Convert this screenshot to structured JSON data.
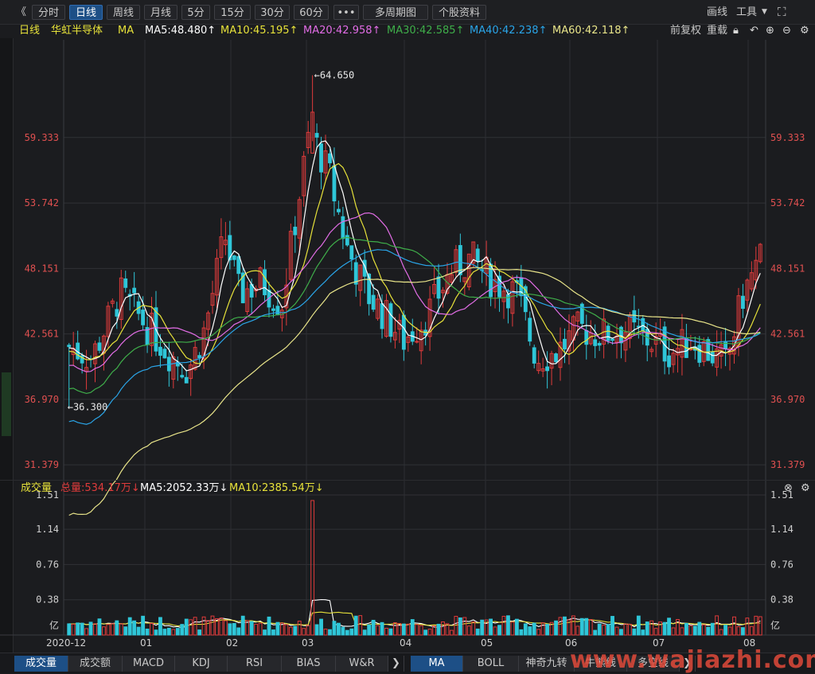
{
  "toolbar": {
    "collapse": "《",
    "tabs": [
      "分时",
      "日线",
      "周线",
      "月线",
      "5分",
      "15分",
      "30分",
      "60分",
      "•••",
      "多周期图",
      "个股资料"
    ],
    "active_tab": "日线",
    "draw_label": "画线",
    "tools_label": "工具",
    "tools_arrow": "▼",
    "fullscreen": "⛶"
  },
  "ma_bar": {
    "period": "日线",
    "stock_name": "华虹半导体",
    "ma_label": "MA",
    "ma5": "MA5:48.480↑",
    "ma10": "MA10:45.195↑",
    "ma20": "MA20:42.958↑",
    "ma30": "MA30:42.585↑",
    "ma40": "MA40:42.238↑",
    "ma60": "MA60:42.118↑",
    "adjust": "前复权",
    "reset": "重载"
  },
  "volume_bar": {
    "label": "成交量",
    "total": "总量:534.17万↓",
    "ma5": "MA5:2052.33万↓",
    "ma10": "MA10:2385.54万↓"
  },
  "colors": {
    "up": "#e03b3b",
    "down": "#2fc6d8",
    "ma5": "#ffffff",
    "ma10": "#e7e23a",
    "ma20": "#e26de6",
    "ma30": "#3fae4a",
    "ma40": "#2aa5e8",
    "ma60": "#e9e58a"
  },
  "chart_data": {
    "type": "candlestick",
    "price_axis_ticks": [
      "59.333",
      "53.742",
      "48.151",
      "42.561",
      "36.970",
      "31.379"
    ],
    "price_ylim": [
      30.3,
      67.0
    ],
    "high_annotation": "←64.650",
    "low_annotation": "←36.300",
    "volume_axis_ticks": [
      "1.51",
      "1.14",
      "0.76",
      "0.38",
      "亿"
    ],
    "volume_ylim": [
      0,
      1.51
    ],
    "x_labels": [
      "2020-12",
      "01",
      "02",
      "03",
      "04",
      "05",
      "06",
      "07",
      "08"
    ],
    "price_high": 64.65,
    "price_low": 36.3
  },
  "bottom_tabs": {
    "left": [
      "成交量",
      "成交额",
      "MACD",
      "KDJ",
      "RSI",
      "BIAS",
      "W&R"
    ],
    "right": [
      "MA",
      "BOLL",
      "神奇九转",
      "牛熊线",
      "多空线"
    ],
    "arrow": "❯"
  },
  "watermark": "www.wajiazhi.com"
}
